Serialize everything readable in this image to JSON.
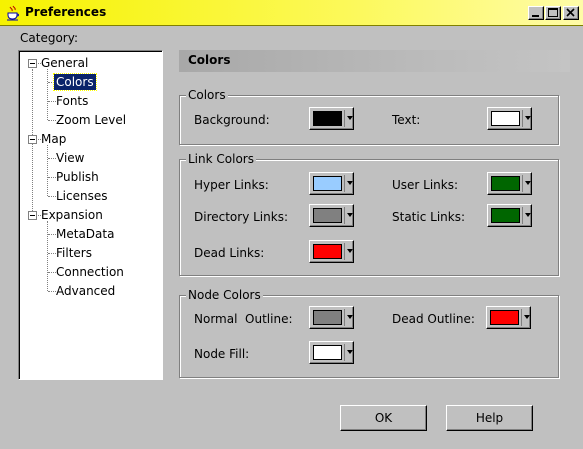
{
  "window": {
    "title": "Preferences"
  },
  "tree": {
    "label": "Category:",
    "nodes": [
      {
        "label": "General",
        "level": 0,
        "expanded": true
      },
      {
        "label": "Colors",
        "level": 1,
        "selected": true
      },
      {
        "label": "Fonts",
        "level": 1
      },
      {
        "label": "Zoom Level",
        "level": 1
      },
      {
        "label": "Map",
        "level": 0,
        "expanded": true
      },
      {
        "label": "View",
        "level": 1
      },
      {
        "label": "Publish",
        "level": 1
      },
      {
        "label": "Licenses",
        "level": 1
      },
      {
        "label": "Expansion",
        "level": 0,
        "expanded": true
      },
      {
        "label": "MetaData",
        "level": 1
      },
      {
        "label": "Filters",
        "level": 1
      },
      {
        "label": "Connection",
        "level": 1
      },
      {
        "label": "Advanced",
        "level": 1
      }
    ]
  },
  "panel": {
    "title": "Colors",
    "groups": {
      "colors": {
        "title": "Colors",
        "background": {
          "label": "Background:",
          "color": "#000000"
        },
        "text": {
          "label": "Text:",
          "color": "#ffffff"
        }
      },
      "link_colors": {
        "title": "Link Colors",
        "hyper": {
          "label": "Hyper Links:",
          "color": "#99ccff"
        },
        "user": {
          "label": "User Links:",
          "color": "#006600"
        },
        "directory": {
          "label": "Directory Links:",
          "color": "#808080"
        },
        "static": {
          "label": "Static Links:",
          "color": "#006600"
        },
        "dead": {
          "label": "Dead Links:",
          "color": "#ff0000"
        }
      },
      "node_colors": {
        "title": "Node Colors",
        "normal_outline": {
          "label": "Normal  Outline:",
          "color": "#808080"
        },
        "dead_outline": {
          "label": "Dead Outline:",
          "color": "#ff0000"
        },
        "node_fill": {
          "label": "Node Fill:",
          "color": "#ffffff"
        }
      }
    }
  },
  "buttons": {
    "ok": "OK",
    "help": "Help"
  }
}
